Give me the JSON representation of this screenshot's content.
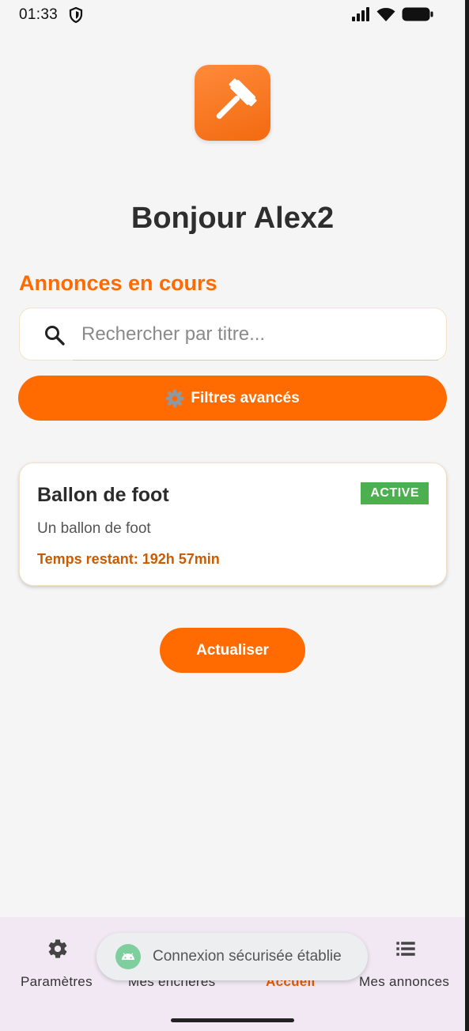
{
  "status_bar": {
    "time": "01:33"
  },
  "header": {
    "greeting": "Bonjour Alex2"
  },
  "section": {
    "title": "Annonces en cours"
  },
  "search": {
    "placeholder": "Rechercher par titre..."
  },
  "filters": {
    "label": "Filtres avancés",
    "icon": "gear-emoji"
  },
  "listings": [
    {
      "title": "Ballon de foot",
      "status": "ACTIVE",
      "description": "Un ballon de foot",
      "time_remaining": "Temps restant: 192h 57min"
    }
  ],
  "actions": {
    "refresh_label": "Actualiser"
  },
  "bottom_nav": {
    "items": [
      {
        "label": "Paramètres",
        "icon": "settings-gear-icon",
        "active": false
      },
      {
        "label": "Mes enchères",
        "icon": "gavel-icon",
        "active": false
      },
      {
        "label": "Accueil",
        "icon": "home-icon",
        "active": true
      },
      {
        "label": "Mes annonces",
        "icon": "list-icon",
        "active": false
      }
    ]
  },
  "toast": {
    "message": "Connexion sécurisée établie",
    "icon": "android-icon"
  },
  "colors": {
    "accent": "#ff6b00",
    "active_badge": "#4caf50",
    "time_text": "#cc5a00",
    "nav_bg": "#f1e8f3"
  }
}
